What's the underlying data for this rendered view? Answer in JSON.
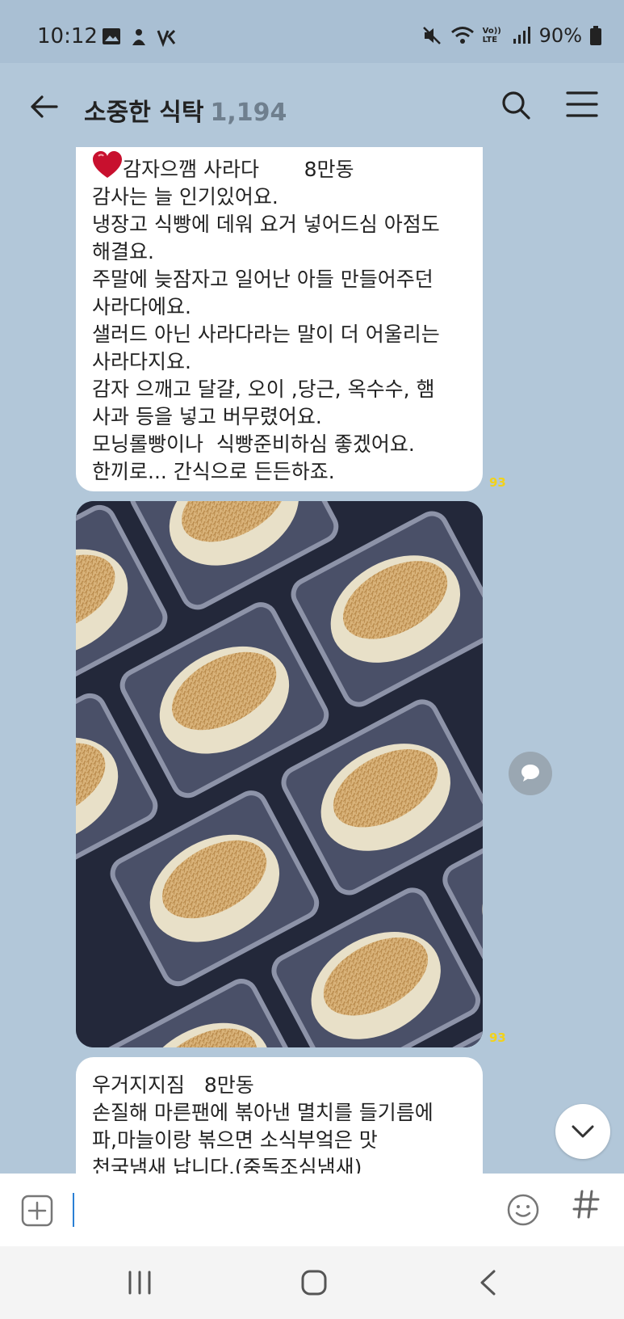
{
  "status": {
    "time": "10:12",
    "battery": "90%",
    "volte": "Vo)) LTE"
  },
  "chat": {
    "title": "소중한 식탁",
    "member_count": "1,194"
  },
  "messages": [
    {
      "lines": [
        "감자으깸 사라다       8만동",
        "감사는 늘 인기있어요.",
        "냉장고 식빵에 데워 요거 넣어드심 아점도",
        "해결요.",
        "주말에 늦잠자고 일어난 아들 만들어주던",
        "사라다에요.",
        "샐러드 아닌 사라다라는 말이 더 어울리는",
        "사라다지요.",
        "감자 으깨고 달걀, 오이 ,당근, 옥수수, 햄",
        "사과 등을 넣고 버무렸어요.",
        "모닝롤빵이나  식빵준비하심 좋겠어요.",
        "한끼로... 간식으로 든든하죠."
      ],
      "read_count": "93"
    },
    {
      "type": "photo",
      "read_count": "93"
    },
    {
      "lines": [
        "우거지지짐   8만동",
        "손질해 마른팬에 볶아낸 멸치를 들기름에",
        "파,마늘이랑 볶으면 소식부엌은 맛",
        "천국냄새 납니다.(중독조심냄새)"
      ]
    }
  ],
  "colors": {
    "chat_bg": "#b2c7d9",
    "read_count": "#f2d21a"
  }
}
